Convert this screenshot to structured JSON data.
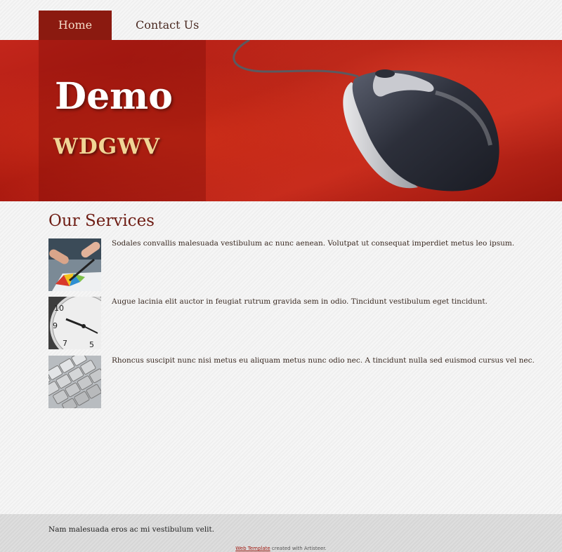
{
  "nav": {
    "items": [
      {
        "label": "Home",
        "active": true
      },
      {
        "label": "Contact Us",
        "active": false
      }
    ]
  },
  "header": {
    "title": "Demo",
    "slogan": "WDGWV"
  },
  "services": {
    "heading": "Our Services",
    "items": [
      {
        "image": "chart-and-hands-photo",
        "text": "Sodales convallis malesuada vestibulum ac nunc aenean. Volutpat ut consequat imperdiet metus leo ipsum."
      },
      {
        "image": "clock-photo",
        "text": "Augue lacinia elit auctor in feugiat rutrum gravida sem in odio. Tincidunt vestibulum eget tincidunt."
      },
      {
        "image": "keyboard-photo",
        "text": "Rhoncus suscipit nunc nisi metus eu aliquam metus nunc odio nec. A tincidunt nulla sed euismod cursus vel nec."
      }
    ]
  },
  "footer": {
    "text": "Nam malesuada eros ac mi vestibulum velit.",
    "credit_link": "Web Template",
    "credit_rest": " created with Artisteer."
  },
  "colors": {
    "accent": "#8b1a10",
    "heading": "#6e1d14",
    "banner": "#c3261b",
    "slogan": "#f0d596"
  }
}
